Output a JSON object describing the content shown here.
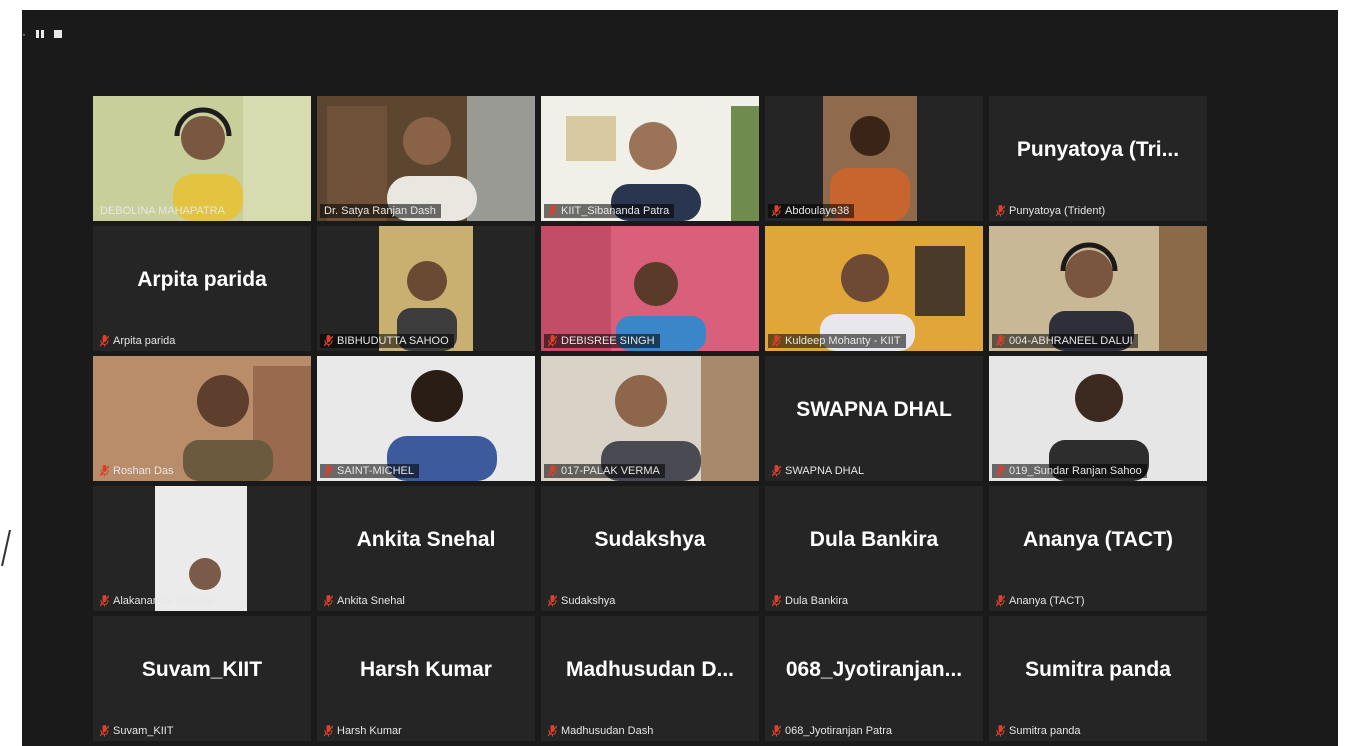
{
  "meeting": {
    "top_bar": {
      "menu_icon": "ellipsis-icon",
      "pause_icon": "pause-icon",
      "stop_icon": "stop-icon"
    },
    "colors": {
      "background": "#1a1a1a",
      "tile": "#252525",
      "speaker_outline": "#d8e35a",
      "muted_mic": "#d9412c"
    }
  },
  "participants": [
    {
      "name": "DEBOLINA MAHAPATRA",
      "display": "",
      "video": true,
      "muted": false
    },
    {
      "name": "Dr. Satya Ranjan Dash",
      "display": "",
      "video": true,
      "muted": false,
      "speaking": true
    },
    {
      "name": "KIIT_Sibananda Patra",
      "display": "",
      "video": true,
      "muted": true
    },
    {
      "name": "Abdoulaye38",
      "display": "",
      "video": true,
      "muted": true
    },
    {
      "name": "Punyatoya  (Trident)",
      "display": "Punyatoya  (Tri...",
      "video": false,
      "muted": true
    },
    {
      "name": "Arpita parida",
      "display": "Arpita parida",
      "video": false,
      "muted": true
    },
    {
      "name": "BIBHUDUTTA SAHOO",
      "display": "",
      "video": true,
      "muted": true
    },
    {
      "name": "DEBISREE SINGH",
      "display": "",
      "video": true,
      "muted": true
    },
    {
      "name": "Kuldeep Mohanty - KIIT",
      "display": "",
      "video": true,
      "muted": true
    },
    {
      "name": "004-ABHRANEEL DALUI",
      "display": "",
      "video": true,
      "muted": true
    },
    {
      "name": "Roshan Das",
      "display": "",
      "video": true,
      "muted": true
    },
    {
      "name": "SAINT-MICHEL",
      "display": "",
      "video": true,
      "muted": true
    },
    {
      "name": "017-PALAK VERMA",
      "display": "",
      "video": true,
      "muted": true
    },
    {
      "name": "SWAPNA DHAL",
      "display": "SWAPNA DHAL",
      "video": false,
      "muted": true
    },
    {
      "name": "019_Sundar Ranjan Sahoo",
      "display": "",
      "video": true,
      "muted": true
    },
    {
      "name": "Alakananda Tripathy",
      "display": "",
      "video": true,
      "muted": true
    },
    {
      "name": "Ankita Snehal",
      "display": "Ankita Snehal",
      "video": false,
      "muted": true
    },
    {
      "name": "Sudakshya",
      "display": "Sudakshya",
      "video": false,
      "muted": true
    },
    {
      "name": "Dula Bankira",
      "display": "Dula Bankira",
      "video": false,
      "muted": true
    },
    {
      "name": "Ananya (TACT)",
      "display": "Ananya (TACT)",
      "video": false,
      "muted": true
    },
    {
      "name": "Suvam_KIIT",
      "display": "Suvam_KIIT",
      "video": false,
      "muted": true
    },
    {
      "name": "Harsh Kumar",
      "display": "Harsh Kumar",
      "video": false,
      "muted": true
    },
    {
      "name": "Madhusudan Dash",
      "display": "Madhusudan  D...",
      "video": false,
      "muted": true
    },
    {
      "name": "068_Jyotiranjan Patra",
      "display": "068_Jyotiranjan...",
      "video": false,
      "muted": true
    },
    {
      "name": "Sumitra panda",
      "display": "Sumitra panda",
      "video": false,
      "muted": true
    }
  ]
}
